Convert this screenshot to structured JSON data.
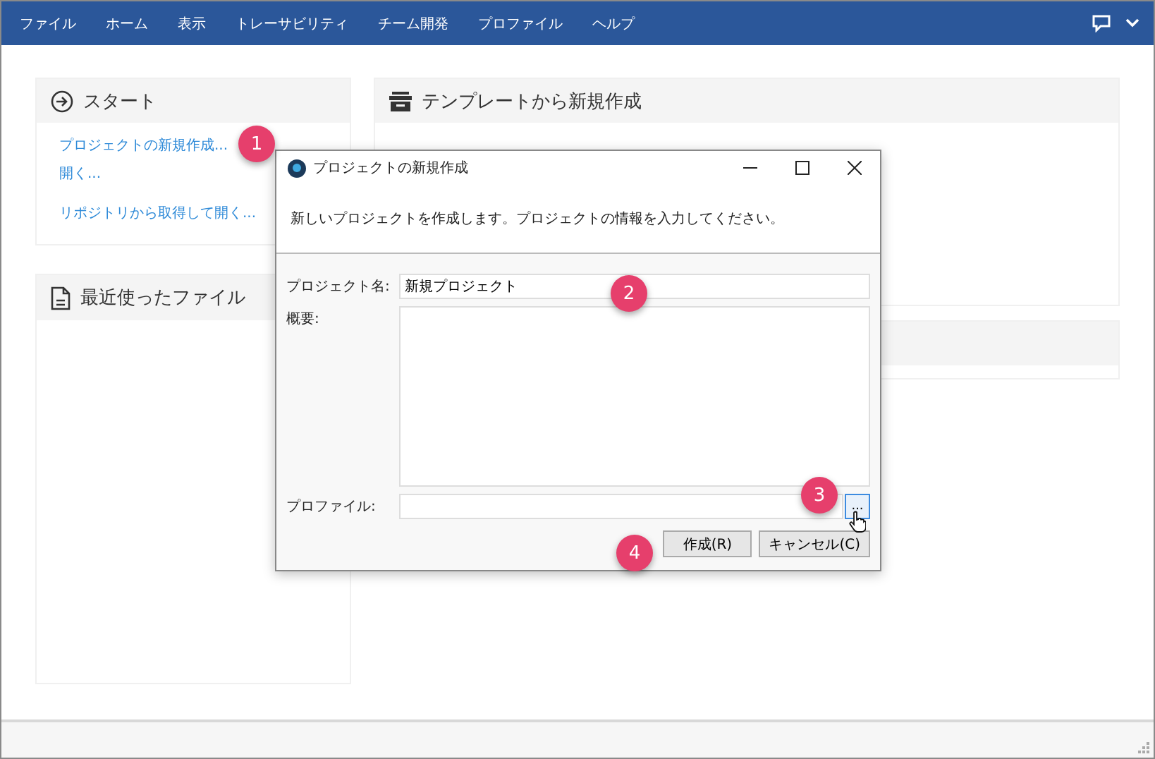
{
  "menu": {
    "items": [
      "ファイル",
      "ホーム",
      "表示",
      "トレーサビリティ",
      "チーム開発",
      "プロファイル",
      "ヘルプ"
    ]
  },
  "start_panel": {
    "title": "スタート",
    "links": [
      "プロジェクトの新規作成...",
      "開く...",
      "リポジトリから取得して開く..."
    ]
  },
  "recent_panel": {
    "title": "最近使ったファイル"
  },
  "template_panel": {
    "title": "テンプレートから新規作成"
  },
  "dialog": {
    "title": "プロジェクトの新規作成",
    "description": "新しいプロジェクトを作成します。プロジェクトの情報を入力してください。",
    "fields": [
      {
        "label": "プロジェクト名:",
        "kind": "text",
        "value": "新規プロジェクト"
      },
      {
        "label": "概要:",
        "kind": "textarea"
      },
      {
        "label": "プロファイル:",
        "kind": "browse",
        "button": "..."
      }
    ],
    "buttons": [
      "作成(R)",
      "キャンセル(C)"
    ]
  },
  "callouts": [
    "1",
    "2",
    "3",
    "4"
  ]
}
